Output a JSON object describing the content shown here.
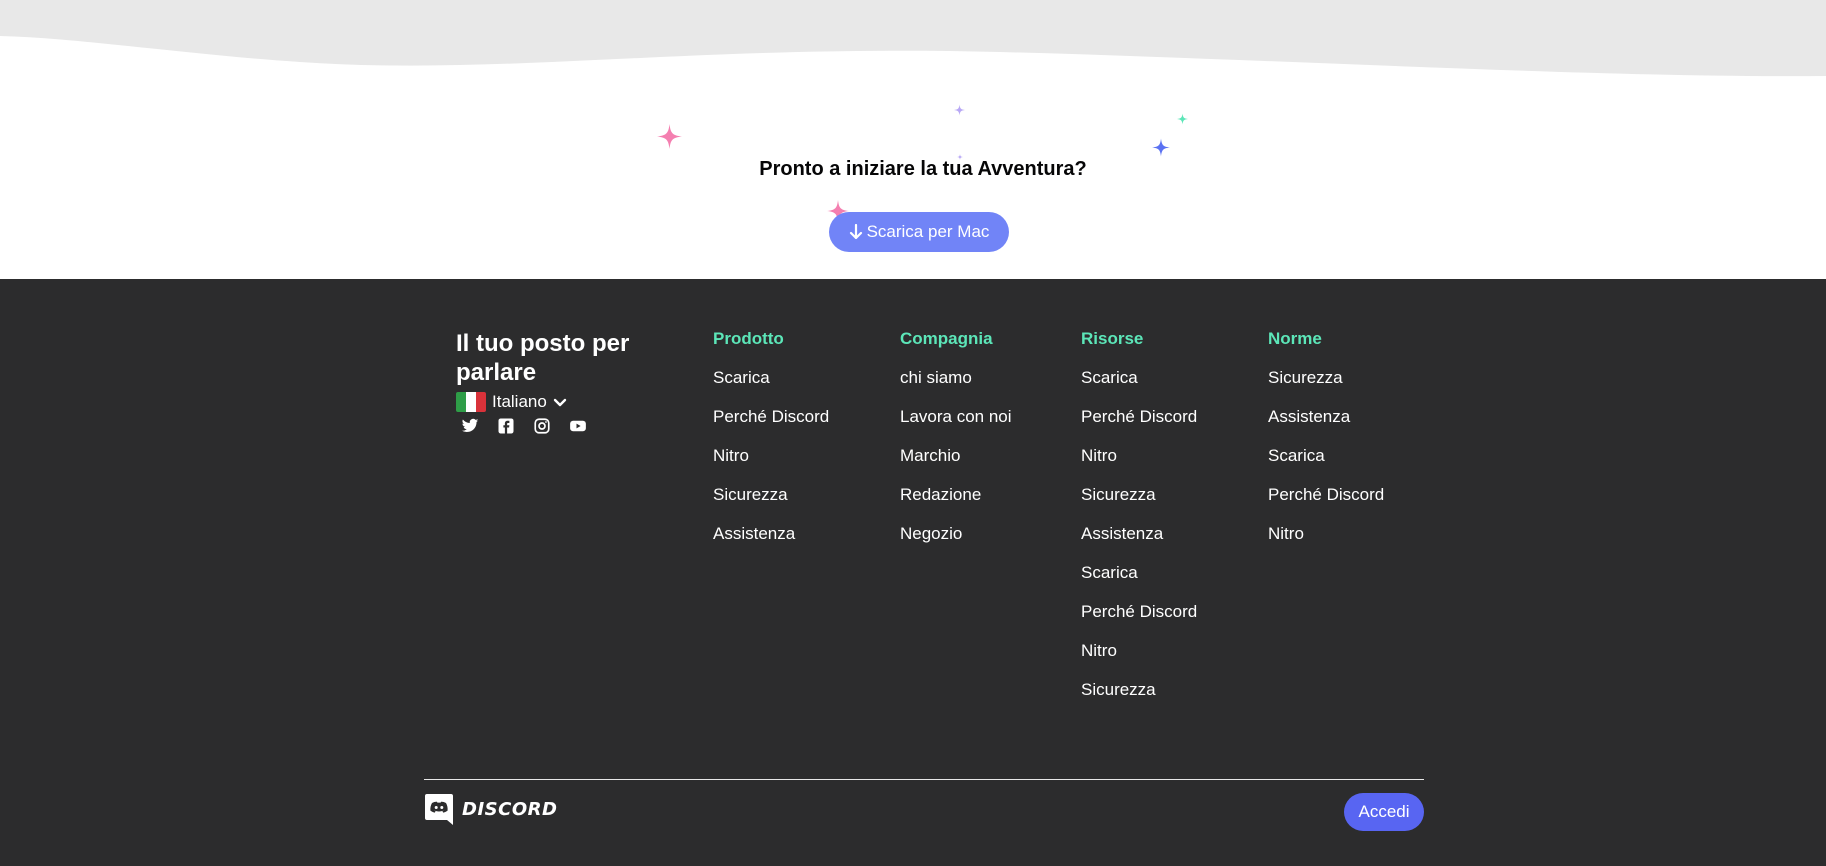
{
  "hero": {
    "title": "Pronto a iniziare la tua Avventura?",
    "download_label": "Scarica per Mac",
    "download_icon": "arrow-down-icon",
    "colors": {
      "wave": "#e8e8e8",
      "button": "#7184f7",
      "sparkle_pink": "#f47fb0",
      "sparkle_blue": "#5b72f2",
      "sparkle_green": "#5ce6b8",
      "sparkle_violet": "#b8a8f5"
    }
  },
  "footer": {
    "tagline": "Il tuo posto per parlare",
    "language": {
      "label": "Italiano",
      "flag": "flag-italy-icon",
      "chevron": "chevron-down-icon"
    },
    "socials": [
      "twitter-icon",
      "facebook-icon",
      "instagram-icon",
      "youtube-icon"
    ],
    "columns": [
      {
        "heading": "Prodotto",
        "links": [
          "Scarica",
          "Perché Discord",
          "Nitro",
          "Sicurezza",
          "Assistenza"
        ]
      },
      {
        "heading": "Compagnia",
        "links": [
          "chi siamo",
          "Lavora con noi",
          "Marchio",
          "Redazione",
          "Negozio"
        ]
      },
      {
        "heading": "Risorse",
        "links": [
          "Scarica",
          "Perché Discord",
          "Nitro",
          "Sicurezza",
          "Assistenza",
          "Scarica",
          "Perché Discord",
          "Nitro",
          "Sicurezza"
        ]
      },
      {
        "heading": "Norme",
        "links": [
          "Sicurezza",
          "Assistenza",
          "Scarica",
          "Perché Discord",
          "Nitro"
        ]
      }
    ],
    "logo_text": "DISCORD",
    "logo_icon": "discord-logo-icon",
    "login_label": "Accedi",
    "colors": {
      "background": "#2c2c2d",
      "heading": "#5ce6b8",
      "login_button": "#5865f2"
    }
  }
}
